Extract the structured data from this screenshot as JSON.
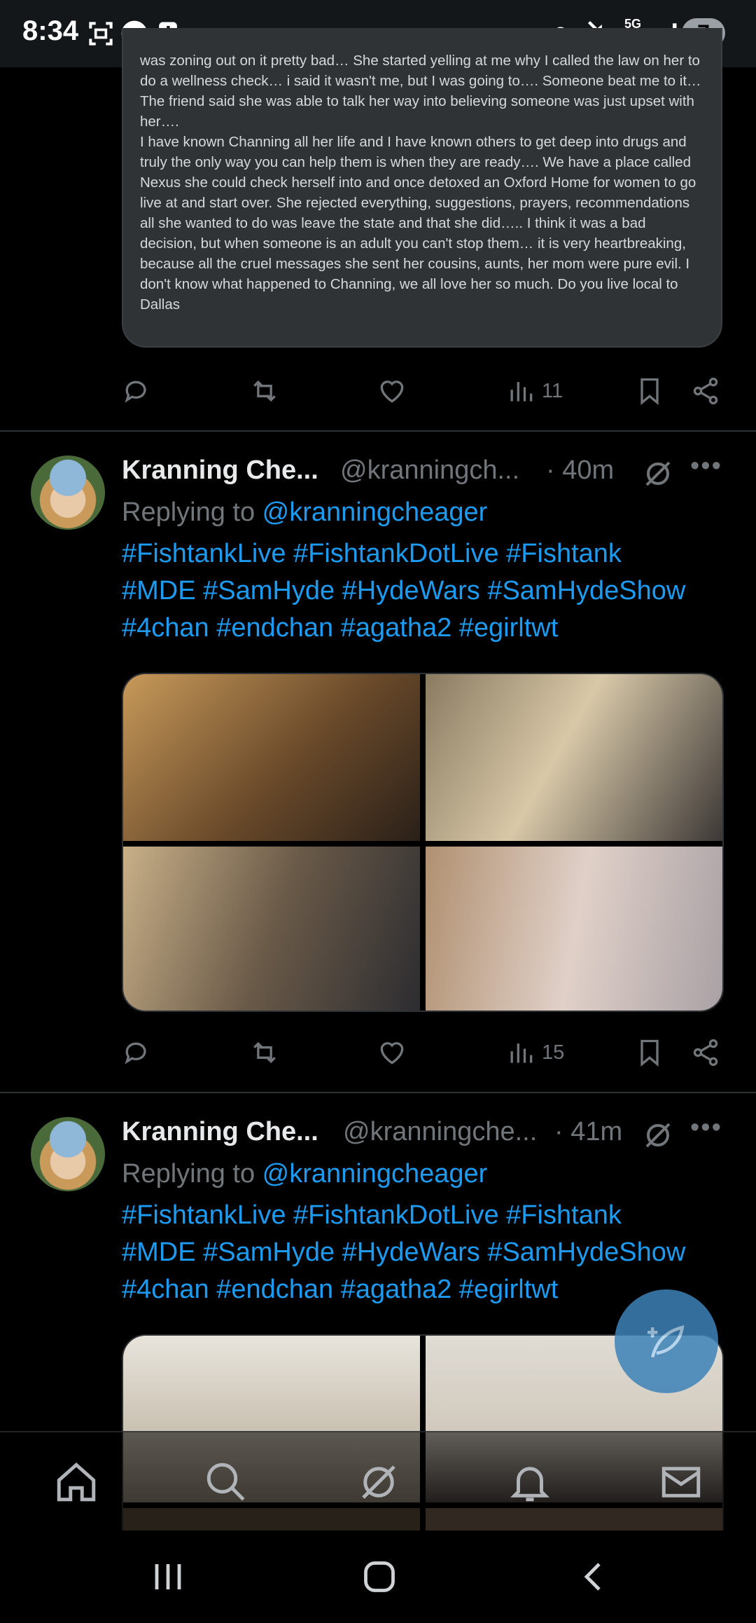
{
  "status_bar": {
    "time": "8:34",
    "battery": "7",
    "network": "5G",
    "icons": [
      "screenshot-icon",
      "app-icon",
      "alert-icon",
      "vpn-key-icon",
      "mute-icon",
      "5g-icon",
      "signal-icon"
    ]
  },
  "quoted_post": {
    "paragraphs": [
      "was zoning out on it pretty bad… She started yelling at me why I called the law on her to do a wellness check… i said it wasn't me, but I was going to…. Someone beat me to it…",
      "The friend said she was able to talk her way into believing someone was just upset with her….",
      "I have known Channing all her life and I have known others to get deep into drugs and truly the only way you can help them is when they are ready…. We have a place called Nexus she could check herself into and once detoxed an Oxford Home for women to go live at and start over. She rejected everything, suggestions, prayers, recommendations all she wanted to do was leave the state and that she did….. I think it was a bad decision, but when someone is an adult you can't stop them… it is very heartbreaking, because all the cruel messages she sent her cousins, aunts, her mom were pure evil. I don't know what happened to Channing, we all love her so much. Do you live local to Dallas"
    ],
    "views": "11"
  },
  "posts": [
    {
      "display_name": "Kranning Che...",
      "handle": "@kranningch...",
      "time": "· 40m",
      "replying_label": "Replying to ",
      "replying_to": "@kranningcheager",
      "hashtags_line1": "#FishtankLive #FishtankDotLive #Fishtank",
      "hashtags_line2": "#MDE #SamHyde #HydeWars #SamHydeShow",
      "hashtags_line3": "#4chan #endchan #agatha2 #egirltwt",
      "views": "15"
    },
    {
      "display_name": "Kranning Che...",
      "handle": "@kranningche...",
      "time": "· 41m",
      "replying_label": "Replying to ",
      "replying_to": "@kranningcheager",
      "hashtags_line1": "#FishtankLive #FishtankDotLive #Fishtank",
      "hashtags_line2": "#MDE #SamHyde #HydeWars #SamHydeShow",
      "hashtags_line3": "#4chan #endchan #agatha2 #egirltwt"
    }
  ],
  "colors": {
    "link": "#1d9bf0",
    "muted": "#71767b",
    "text": "#e7e9ea",
    "background": "#000000"
  }
}
